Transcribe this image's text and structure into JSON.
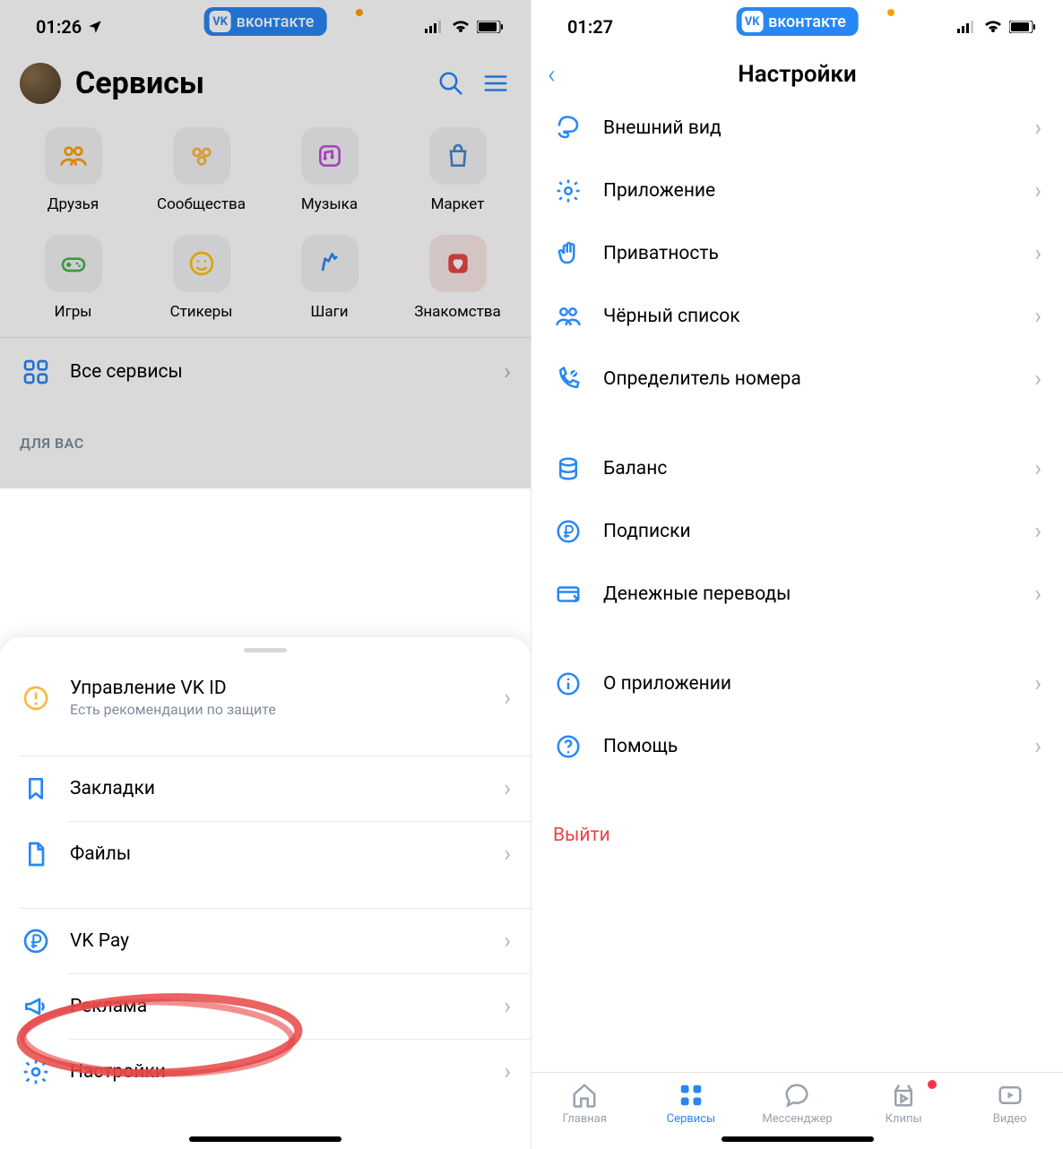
{
  "left": {
    "status_time": "01:26",
    "vk_pill": "вконтакте",
    "header": {
      "title": "Сервисы"
    },
    "services": [
      {
        "icon": "friends",
        "color": "#ff9e00",
        "label": "Друзья"
      },
      {
        "icon": "communities",
        "color": "#ffb73d",
        "label": "Сообщества"
      },
      {
        "icon": "music",
        "color": "#c14fd7",
        "label": "Музыка"
      },
      {
        "icon": "market",
        "color": "#4bb34b",
        "label": "Маркет"
      },
      {
        "icon": "games",
        "color": "#4bb34b",
        "label": "Игры"
      },
      {
        "icon": "stickers",
        "color": "#ffc107",
        "label": "Стикеры"
      },
      {
        "icon": "steps",
        "color": "#2787f5",
        "label": "Шаги"
      },
      {
        "icon": "dating",
        "color": "#e64646",
        "label": "Знакомства"
      }
    ],
    "all_services": "Все сервисы",
    "for_you_label": "ДЛЯ ВАС",
    "sheet": {
      "vkid_title": "Управление VK ID",
      "vkid_sub": "Есть рекомендации по защите",
      "items": [
        {
          "label": "Закладки",
          "icon": "bookmark"
        },
        {
          "label": "Файлы",
          "icon": "file"
        }
      ],
      "items2": [
        {
          "label": "VK Pay",
          "icon": "ruble"
        },
        {
          "label": "Реклама",
          "icon": "megaphone"
        },
        {
          "label": "Настройки",
          "icon": "gear"
        }
      ]
    }
  },
  "right": {
    "status_time": "01:27",
    "vk_pill": "вконтакте",
    "nav_title": "Настройки",
    "groups": [
      [
        {
          "label": "Внешний вид",
          "icon": "appearance"
        },
        {
          "label": "Приложение",
          "icon": "gear"
        },
        {
          "label": "Приватность",
          "icon": "hand"
        },
        {
          "label": "Чёрный список",
          "icon": "blocklist"
        },
        {
          "label": "Определитель номера",
          "icon": "caller-id"
        }
      ],
      [
        {
          "label": "Баланс",
          "icon": "balance"
        },
        {
          "label": "Подписки",
          "icon": "ruble-circle"
        },
        {
          "label": "Денежные переводы",
          "icon": "transfer"
        }
      ],
      [
        {
          "label": "О приложении",
          "icon": "info"
        },
        {
          "label": "Помощь",
          "icon": "help"
        }
      ]
    ],
    "logout": "Выйти",
    "tabs": [
      {
        "label": "Главная",
        "icon": "home"
      },
      {
        "label": "Сервисы",
        "icon": "services",
        "active": true
      },
      {
        "label": "Мессенджер",
        "icon": "chat"
      },
      {
        "label": "Клипы",
        "icon": "clips",
        "badge": true
      },
      {
        "label": "Видео",
        "icon": "video"
      }
    ]
  }
}
